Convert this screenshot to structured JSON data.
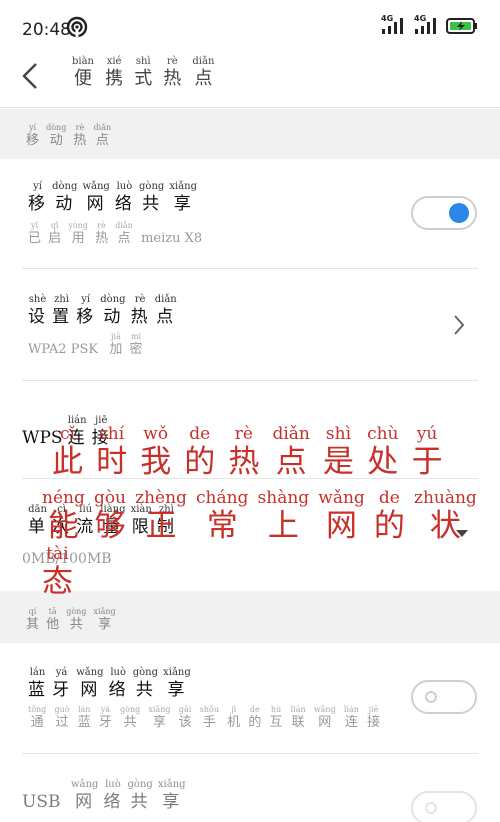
{
  "status": {
    "time": "20:48",
    "signal1_label": "4G",
    "signal2_label": "4G"
  },
  "appbar": {
    "title": [
      {
        "h": "便",
        "p": "biàn"
      },
      {
        "h": "携",
        "p": "xié"
      },
      {
        "h": "式",
        "p": "shì"
      },
      {
        "h": "热",
        "p": "rè"
      },
      {
        "h": "点",
        "p": "diǎn"
      }
    ]
  },
  "section_mobile": {
    "label": [
      {
        "h": "移",
        "p": "yí"
      },
      {
        "h": "动",
        "p": "dòng"
      },
      {
        "h": "热",
        "p": "rè"
      },
      {
        "h": "点",
        "p": "diǎn"
      }
    ]
  },
  "row_mobile_hotspot": {
    "title": [
      {
        "h": "移",
        "p": "yí"
      },
      {
        "h": "动",
        "p": "dòng"
      },
      {
        "h": "网",
        "p": "wǎng"
      },
      {
        "h": "络",
        "p": "luò"
      },
      {
        "h": "共",
        "p": "gòng"
      },
      {
        "h": "享",
        "p": "xiǎng"
      }
    ],
    "sub": [
      {
        "h": "已",
        "p": "yǐ"
      },
      {
        "h": "启",
        "p": "qǐ"
      },
      {
        "h": "用",
        "p": "yòng"
      },
      {
        "h": "热",
        "p": "rè"
      },
      {
        "h": "点",
        "p": "diǎn"
      },
      {
        "h": " meizu X8",
        "p": ""
      }
    ],
    "toggle_state": "on"
  },
  "row_setup": {
    "title": [
      {
        "h": "设",
        "p": "shè"
      },
      {
        "h": "置",
        "p": "zhì"
      },
      {
        "h": "移",
        "p": "yí"
      },
      {
        "h": "动",
        "p": "dòng"
      },
      {
        "h": "热",
        "p": "rè"
      },
      {
        "h": "点",
        "p": "diǎn"
      }
    ],
    "sub": [
      {
        "h": "WPA2 PSK ",
        "p": ""
      },
      {
        "h": "加",
        "p": "jiā"
      },
      {
        "h": "密",
        "p": "mì"
      }
    ]
  },
  "row_wps": {
    "title": [
      {
        "h": "WPS",
        "p": ""
      },
      {
        "h": "连",
        "p": "lián"
      },
      {
        "h": "接",
        "p": "jiē"
      }
    ]
  },
  "row_traffic": {
    "title": [
      {
        "h": "单",
        "p": "dān"
      },
      {
        "h": "次",
        "p": "cì"
      },
      {
        "h": "流",
        "p": "liú"
      },
      {
        "h": "量",
        "p": "liàng"
      },
      {
        "h": "限",
        "p": "xiàn"
      },
      {
        "h": "制",
        "p": "zhì"
      }
    ],
    "value": "0MB/100MB"
  },
  "section_other": {
    "label": [
      {
        "h": "其",
        "p": "qí"
      },
      {
        "h": "他",
        "p": "tā"
      },
      {
        "h": "共",
        "p": "gòng"
      },
      {
        "h": "享",
        "p": "xiǎng"
      }
    ]
  },
  "row_bluetooth": {
    "title": [
      {
        "h": "蓝",
        "p": "lán"
      },
      {
        "h": "牙",
        "p": "yá"
      },
      {
        "h": "网",
        "p": "wǎng"
      },
      {
        "h": "络",
        "p": "luò"
      },
      {
        "h": "共",
        "p": "gòng"
      },
      {
        "h": "享",
        "p": "xiǎng"
      }
    ],
    "sub": [
      {
        "h": "通",
        "p": "tōng"
      },
      {
        "h": "过",
        "p": "guò"
      },
      {
        "h": "蓝",
        "p": "lán"
      },
      {
        "h": "牙",
        "p": "yá"
      },
      {
        "h": "共",
        "p": "gòng"
      },
      {
        "h": "享",
        "p": "xiǎng"
      },
      {
        "h": "该",
        "p": "gāi"
      },
      {
        "h": "手",
        "p": "shǒu"
      },
      {
        "h": "机",
        "p": "jī"
      },
      {
        "h": "的",
        "p": "de"
      },
      {
        "h": "互",
        "p": "hù"
      },
      {
        "h": "联",
        "p": "lián"
      },
      {
        "h": "网",
        "p": "wǎng"
      },
      {
        "h": "连",
        "p": "lián"
      },
      {
        "h": "接",
        "p": "jiē"
      }
    ],
    "toggle_state": "off"
  },
  "row_usb": {
    "title": [
      {
        "h": "USB ",
        "p": ""
      },
      {
        "h": "网",
        "p": "wǎng"
      },
      {
        "h": "络",
        "p": "luò"
      },
      {
        "h": "共",
        "p": "gòng"
      },
      {
        "h": "享",
        "p": "xiǎng"
      }
    ],
    "toggle_state": "off"
  },
  "overlay_caption": {
    "line1": [
      {
        "h": "此",
        "p": "cǐ"
      },
      {
        "h": "时",
        "p": "shí"
      },
      {
        "h": "我",
        "p": "wǒ"
      },
      {
        "h": "的",
        "p": "de"
      },
      {
        "h": "热",
        "p": "rè"
      },
      {
        "h": "点",
        "p": "diǎn"
      },
      {
        "h": "是",
        "p": "shì"
      },
      {
        "h": "处",
        "p": "chù"
      },
      {
        "h": "于",
        "p": "yú"
      }
    ],
    "line2": [
      {
        "h": "能",
        "p": "néng"
      },
      {
        "h": "够",
        "p": "gòu"
      },
      {
        "h": "正",
        "p": "zhèng"
      },
      {
        "h": "常",
        "p": "cháng"
      },
      {
        "h": "上",
        "p": "shàng"
      },
      {
        "h": "网",
        "p": "wǎng"
      },
      {
        "h": "的",
        "p": "de"
      },
      {
        "h": "状",
        "p": "zhuàng"
      },
      {
        "h": "态",
        "p": "tài"
      }
    ]
  },
  "colors": {
    "accent_blue": "#2a87e6",
    "overlay_red": "#c8302a",
    "section_bg": "#f1f1f1"
  }
}
